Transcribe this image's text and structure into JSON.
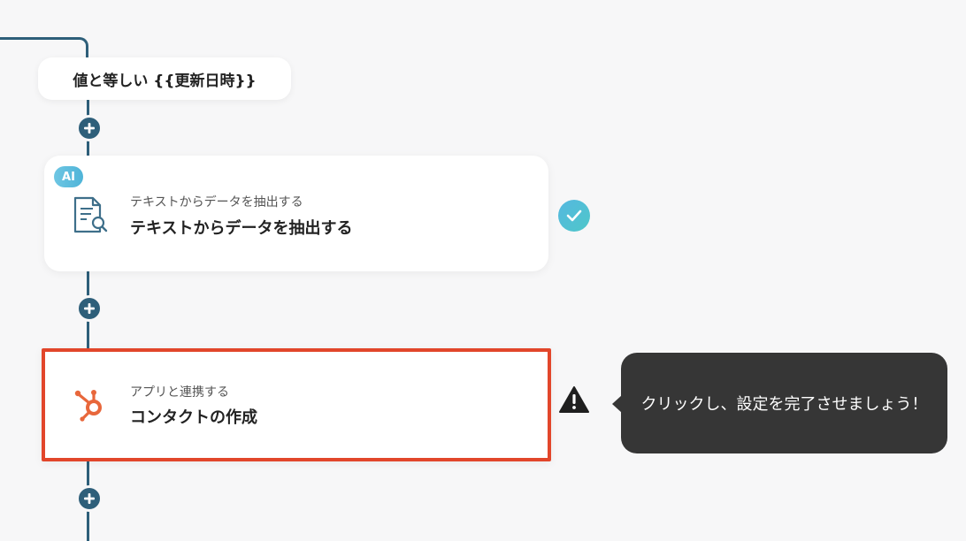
{
  "flow": {
    "condition_label": "値と等しい {{更新日時}}",
    "steps": [
      {
        "badge": "AI",
        "subtitle": "テキストからデータを抽出する",
        "title": "テキストからデータを抽出する",
        "icon": "document-search-icon",
        "status": "completed",
        "status_icon": "check-circle-icon"
      },
      {
        "subtitle": "アプリと連携する",
        "title": "コンタクトの作成",
        "icon": "hubspot-icon",
        "status": "incomplete",
        "status_icon": "warning-icon"
      }
    ],
    "add_step_icon": "plus-icon"
  },
  "tooltip": {
    "text": "クリックし、設定を完了させましょう！"
  },
  "colors": {
    "connector": "#2e5f7a",
    "highlight_border": "#e2462b",
    "hubspot_orange": "#e8673b",
    "check_gradient_start": "#55b8e0",
    "check_gradient_end": "#4fc7c9",
    "tooltip_bg": "#363636",
    "background": "#f7f7f8"
  }
}
